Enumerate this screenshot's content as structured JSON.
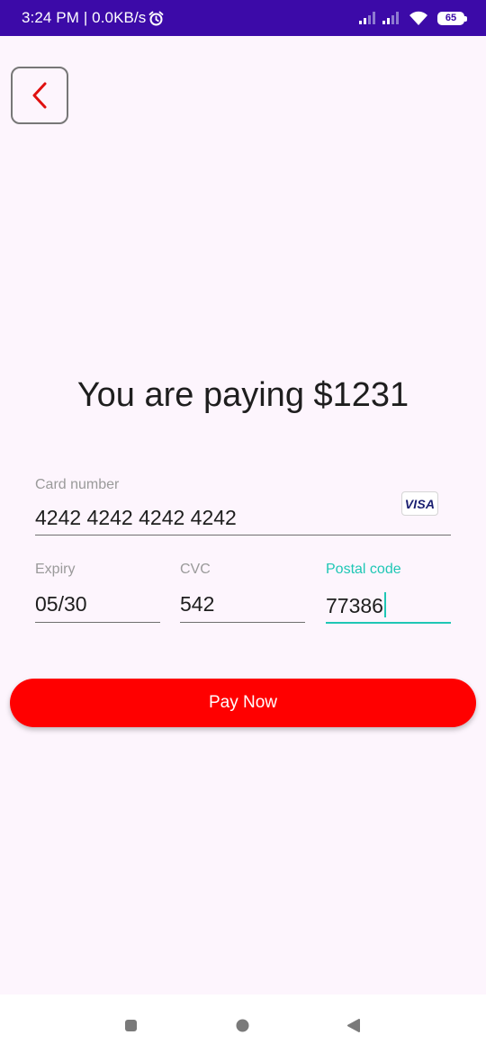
{
  "status_bar": {
    "time_speed": "3:24 PM | 0.0KB/s",
    "battery_level": "65",
    "colors": {
      "background": "#3c0aa8",
      "foreground": "#ffffff"
    }
  },
  "icons": {
    "back": "chevron-left-icon",
    "alarm": "alarm-clock-icon",
    "signal": "cellular-signal-icon",
    "wifi": "wifi-icon",
    "battery": "battery-icon",
    "card_brand": "visa-icon"
  },
  "title": "You are paying $1231",
  "card": {
    "number_label": "Card number",
    "number_value": "4242 4242 4242 4242",
    "brand": "VISA",
    "expiry_label": "Expiry",
    "expiry_value": "05/30",
    "cvc_label": "CVC",
    "cvc_value": "542",
    "postal_label": "Postal code",
    "postal_value": "77386"
  },
  "pay_button": {
    "label": "Pay Now"
  },
  "colors": {
    "background": "#fdf5fd",
    "accent": "#ff0000",
    "focus": "#1fc7b5",
    "back_chevron": "#e01010"
  }
}
